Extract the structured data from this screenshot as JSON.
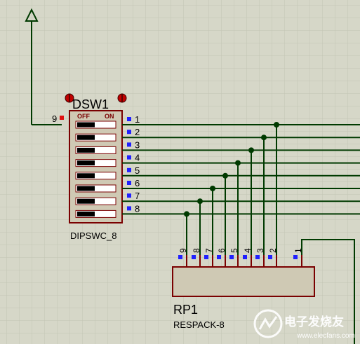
{
  "colors": {
    "background": "#d6d7c8",
    "grid": "#c3c4b4",
    "wire": "#003a00",
    "body_stroke": "#7a0000",
    "body_fill": "#cfc9b4",
    "pin_blue": "#2020ff",
    "pin_red": "#e01010",
    "text": "#000000",
    "watermark": "#ffffff"
  },
  "component_dsw": {
    "ref": "DSW1",
    "type": "DIPSWC_8",
    "off_label": "OFF",
    "on_label": "ON",
    "common_pin": "9",
    "pins": [
      "1",
      "2",
      "3",
      "4",
      "5",
      "6",
      "7",
      "8"
    ],
    "switch_state": "off"
  },
  "component_rp": {
    "ref": "RP1",
    "type": "RESPACK-8",
    "pins": [
      "9",
      "8",
      "7",
      "6",
      "5",
      "4",
      "3",
      "2",
      "1"
    ]
  },
  "power_symbol": {
    "icon": "power-arrow-icon"
  },
  "watermark": {
    "line1": "电子发烧友",
    "line2": "www.elecfans.com",
    "icon": "elecfans-logo-icon"
  }
}
